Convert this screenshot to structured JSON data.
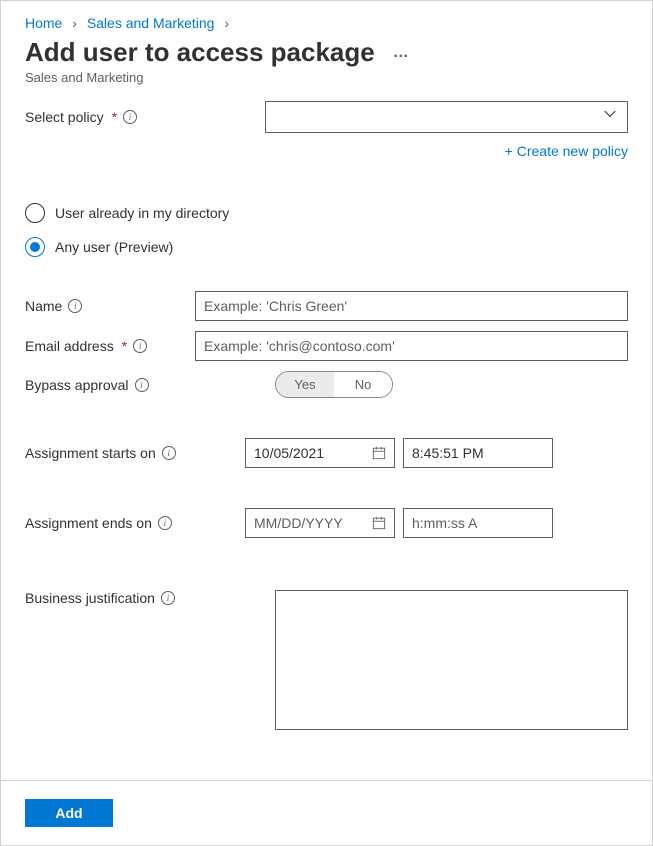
{
  "breadcrumb": {
    "home": "Home",
    "section": "Sales and Marketing"
  },
  "page": {
    "title": "Add user to access package",
    "subtitle": "Sales and Marketing"
  },
  "policy": {
    "label": "Select policy",
    "selected": "",
    "create_link": "+ Create new policy"
  },
  "user_source": {
    "option_directory": "User already in my directory",
    "option_any": "Any user (Preview)"
  },
  "name": {
    "label": "Name",
    "placeholder": "Example: 'Chris Green'",
    "value": ""
  },
  "email": {
    "label": "Email address",
    "placeholder": "Example: 'chris@contoso.com'",
    "value": ""
  },
  "bypass": {
    "label": "Bypass approval",
    "yes": "Yes",
    "no": "No"
  },
  "starts": {
    "label": "Assignment starts on",
    "date": "10/05/2021",
    "time": "8:45:51 PM"
  },
  "ends": {
    "label": "Assignment ends on",
    "date_placeholder": "MM/DD/YYYY",
    "time_placeholder": "h:mm:ss A"
  },
  "justification": {
    "label": "Business justification",
    "value": ""
  },
  "footer": {
    "add": "Add"
  }
}
